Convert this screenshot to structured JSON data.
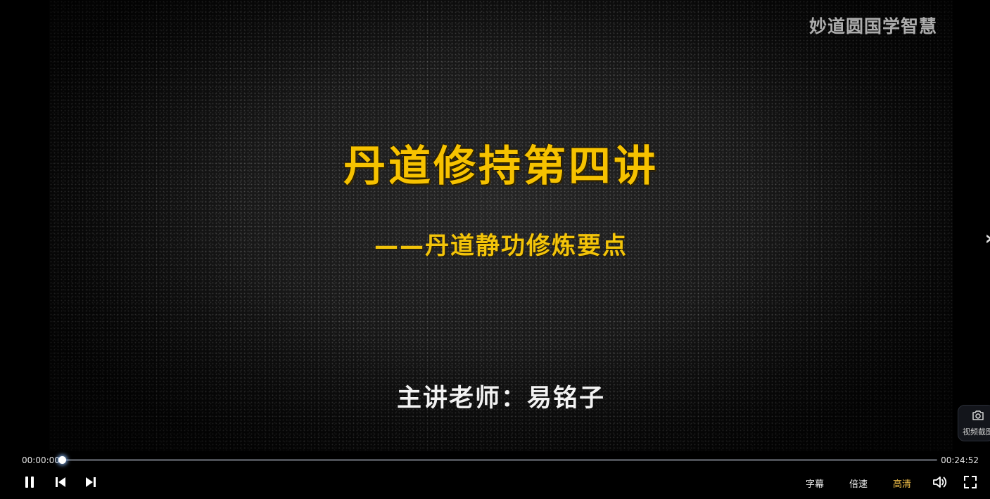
{
  "video": {
    "watermark": "妙道圆国学智慧",
    "title": "丹道修持第四讲",
    "subtitle": "——丹道静功修炼要点",
    "lecturer": "主讲老师：易铭子"
  },
  "side": {
    "screenshot_label": "视频截图",
    "screenshot_icon": "camera-icon",
    "next_arrow_icon": "chevron-right-icon"
  },
  "progress": {
    "current_time": "00:00:00",
    "total_time": "00:24:52",
    "played_fraction": 0.0,
    "accent_color": "#9ec7ff"
  },
  "controls": {
    "play_pause_icon": "pause-icon",
    "prev_icon": "skip-previous-icon",
    "next_icon": "skip-next-icon",
    "subtitle_label": "字幕",
    "speed_label": "倍速",
    "quality_label": "高清",
    "volume_icon": "volume-icon",
    "fullscreen_icon": "fullscreen-icon"
  },
  "colors": {
    "title_yellow": "#f6c200",
    "quality_highlight": "#f5c24a"
  }
}
